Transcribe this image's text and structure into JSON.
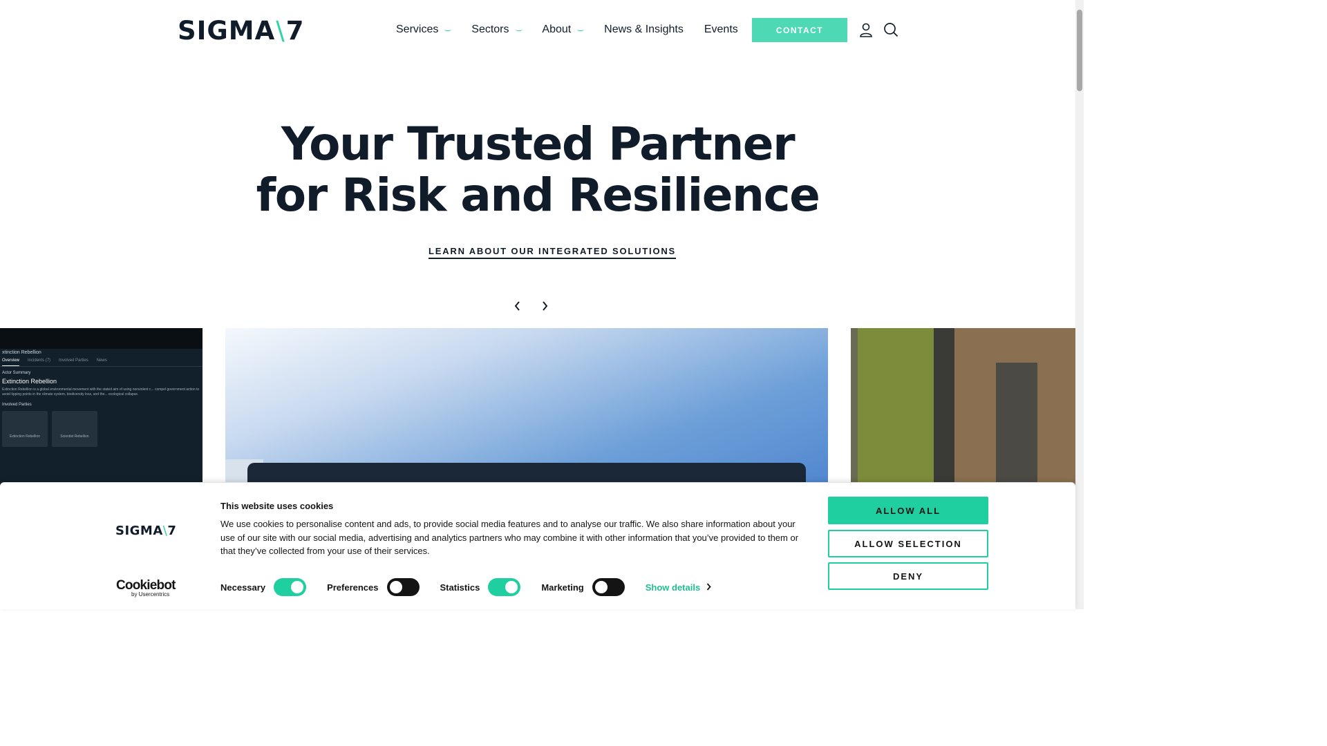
{
  "header": {
    "logo_text_left": "SIGMA",
    "logo_slash": "\\",
    "logo_text_right": "7",
    "nav": [
      {
        "label": "Services",
        "has_dropdown": true
      },
      {
        "label": "Sectors",
        "has_dropdown": true
      },
      {
        "label": "About",
        "has_dropdown": true
      },
      {
        "label": "News & Insights",
        "has_dropdown": false
      },
      {
        "label": "Events",
        "has_dropdown": false
      }
    ],
    "dropdown_glyph": "⌣",
    "contact_label": "CONTACT",
    "icons": [
      "user-icon",
      "search-icon"
    ]
  },
  "hero": {
    "title_line1": "Your Trusted Partner",
    "title_line2": "for Risk and Resilience",
    "link_label": "LEARN ABOUT OUR INTEGRATED SOLUTIONS",
    "prev_icon": "chevron-left-icon",
    "next_icon": "chevron-right-icon"
  },
  "carousel": {
    "left_slide": {
      "title": "xtinction Rebellion",
      "tabs": [
        "Overview",
        "Incidents (7)",
        "Involved Parties",
        "News"
      ],
      "section": "Actor Summary",
      "name": "Extinction Rebellion",
      "description": "Extinction Rebellion is a global environmental movement with the stated aim of using nonviolent c... compel government action to avoid tipping points in the climate system, biodiversity loss, and the... ecological collapse.",
      "parties_label": "Involved Parties",
      "cards": [
        "Extinction Rebellion",
        "Scientist Rebellion"
      ]
    }
  },
  "cookie_banner": {
    "logo_text_left": "SIGMA",
    "logo_slash": "\\",
    "logo_text_right": "7",
    "cookiebot_main": "Cookiebot",
    "cookiebot_sub": "by Usercentrics",
    "title": "This website uses cookies",
    "text": "We use cookies to personalise content and ads, to provide social media features and to analyse our traffic. We also share information about your use of our site with our social media, advertising and analytics partners who may combine it with other information that you’ve provided to them or that they’ve collected from your use of their services.",
    "toggles": [
      {
        "label": "Necessary",
        "on": true
      },
      {
        "label": "Preferences",
        "on": false
      },
      {
        "label": "Statistics",
        "on": true
      },
      {
        "label": "Marketing",
        "on": false
      }
    ],
    "show_details": "Show details",
    "buttons": {
      "allow_all": "ALLOW ALL",
      "allow_selection": "ALLOW SELECTION",
      "deny": "DENY"
    },
    "accent_color": "#1fcf9f"
  },
  "colors": {
    "brand_dark": "#111c2b",
    "brand_accent": "#2fd3ac",
    "contact_bg": "#4fd8b4"
  }
}
